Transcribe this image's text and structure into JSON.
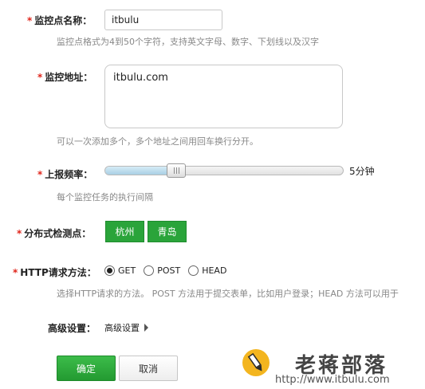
{
  "required_mark": "*",
  "name_field": {
    "label": "监控点名称：",
    "value": "itbulu",
    "hint": "监控点格式为4到50个字符，支持英文字母、数字、下划线以及汉字"
  },
  "address_field": {
    "label": "监控地址：",
    "value": "itbulu.com",
    "hint": "可以一次添加多个，多个地址之间用回车换行分开。"
  },
  "frequency_field": {
    "label": "上报频率：",
    "value_text": "5分钟",
    "level": 0.3,
    "hint": "每个监控任务的执行间隔"
  },
  "distributed_field": {
    "label": "分布式检测点：",
    "points": [
      "杭州",
      "青岛"
    ]
  },
  "method_field": {
    "label": "HTTP请求方法：",
    "options": [
      "GET",
      "POST",
      "HEAD"
    ],
    "selected": "GET",
    "hint": "选择HTTP请求的方法。 POST 方法用于提交表单，比如用户登录；HEAD 方法可以用于"
  },
  "advanced": {
    "label": "高级设置：",
    "link": "高级设置"
  },
  "actions": {
    "ok": "确定",
    "cancel": "取消"
  },
  "watermark": {
    "brand": "老蒋部落",
    "url": "http://www.itbulu.com"
  },
  "colors": {
    "required": "#e0251b",
    "green": "#2aa43a",
    "hint": "#888888"
  },
  "icons": {
    "expand": "caret-right-icon",
    "logo": "pencil-logo-icon"
  }
}
